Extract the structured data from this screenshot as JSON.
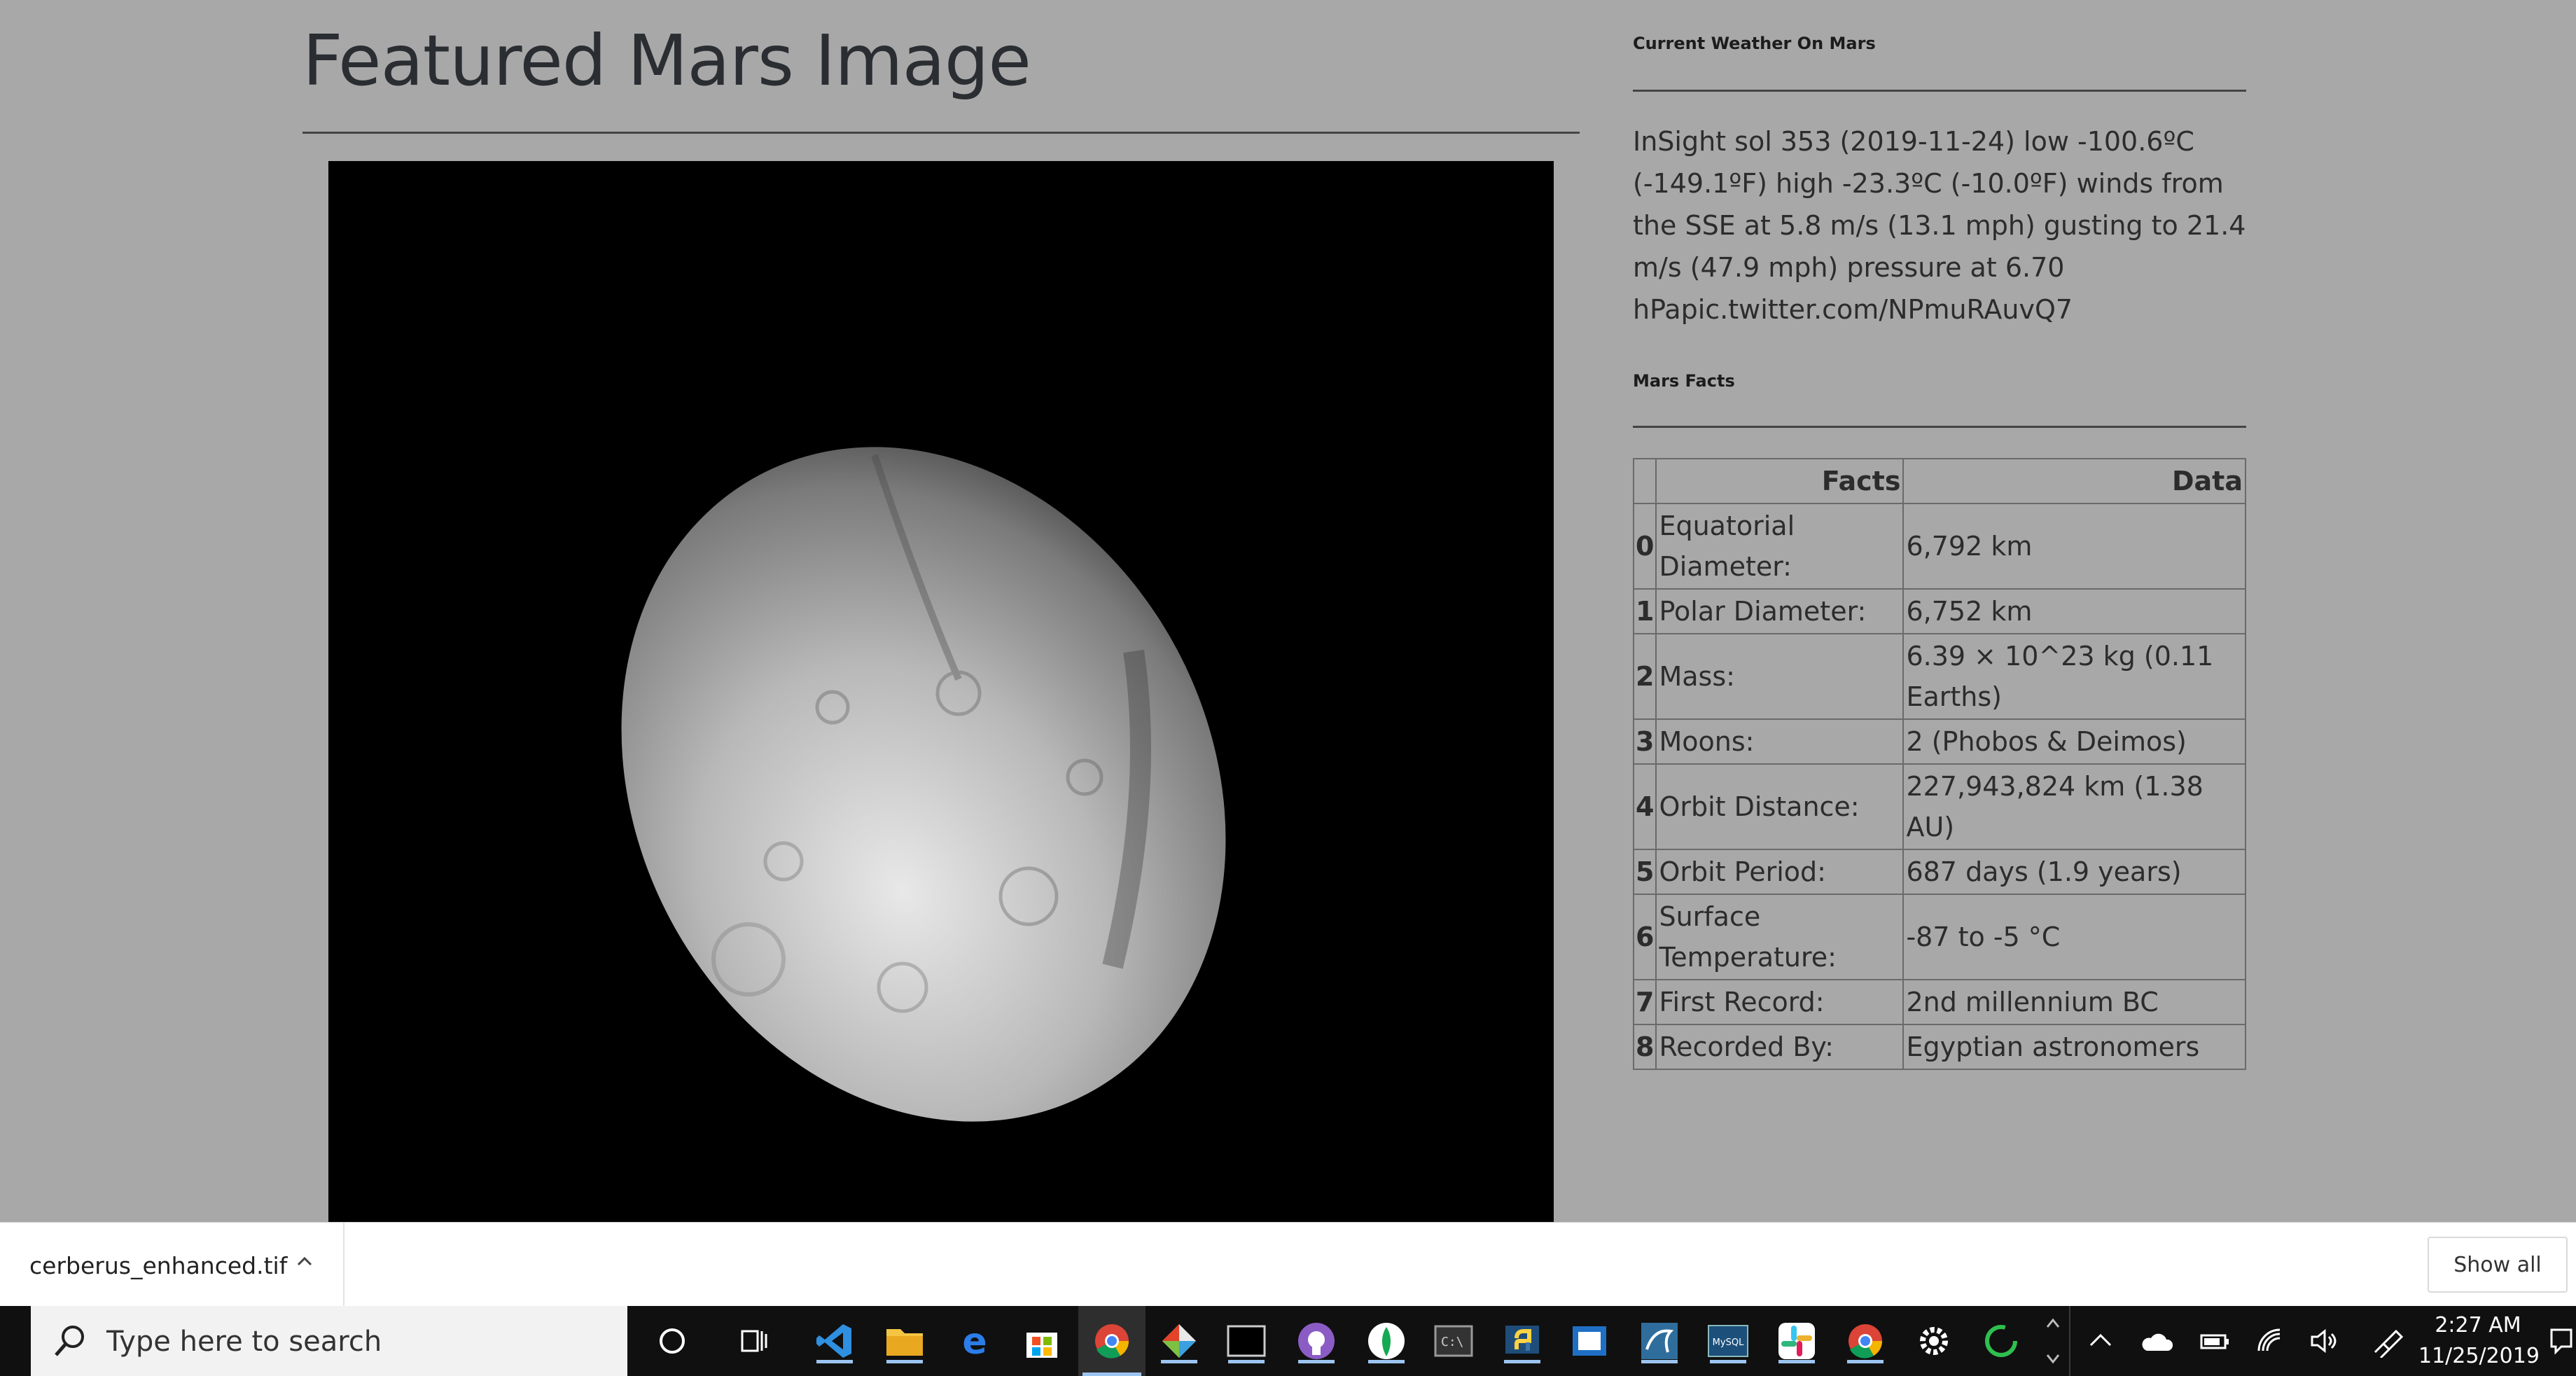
{
  "featured": {
    "title": "Featured Mars Image"
  },
  "weather": {
    "title": "Current Weather On Mars",
    "text": "InSight sol 353 (2019-11-24) low -100.6ºC (-149.1ºF) high -23.3ºC (-10.0ºF) winds from the SSE at 5.8 m/s (13.1 mph) gusting to 21.4 m/s (47.9 mph) pressure at 6.70 hPapic.twitter.com/NPmuRAuvQ7"
  },
  "facts": {
    "title": "Mars Facts",
    "columns": [
      "Facts",
      "Data"
    ],
    "rows": [
      {
        "idx": "0",
        "fact": "Equatorial Diameter:",
        "data": "6,792 km"
      },
      {
        "idx": "1",
        "fact": "Polar Diameter:",
        "data": "6,752 km"
      },
      {
        "idx": "2",
        "fact": "Mass:",
        "data": "6.39 × 10^23 kg (0.11 Earths)"
      },
      {
        "idx": "3",
        "fact": "Moons:",
        "data": "2 (Phobos & Deimos)"
      },
      {
        "idx": "4",
        "fact": "Orbit Distance:",
        "data": "227,943,824 km (1.38 AU)"
      },
      {
        "idx": "5",
        "fact": "Orbit Period:",
        "data": "687 days (1.9 years)"
      },
      {
        "idx": "6",
        "fact": "Surface Temperature:",
        "data": "-87 to -5 °C"
      },
      {
        "idx": "7",
        "fact": "First Record:",
        "data": "2nd millennium BC"
      },
      {
        "idx": "8",
        "fact": "Recorded By:",
        "data": "Egyptian astronomers"
      }
    ]
  },
  "download_bar": {
    "filename": "cerberus_enhanced.tif",
    "show_all": "Show all"
  },
  "taskbar": {
    "search_placeholder": "Type here to search",
    "clock_time": "2:27 AM",
    "clock_date": "11/25/2019"
  }
}
